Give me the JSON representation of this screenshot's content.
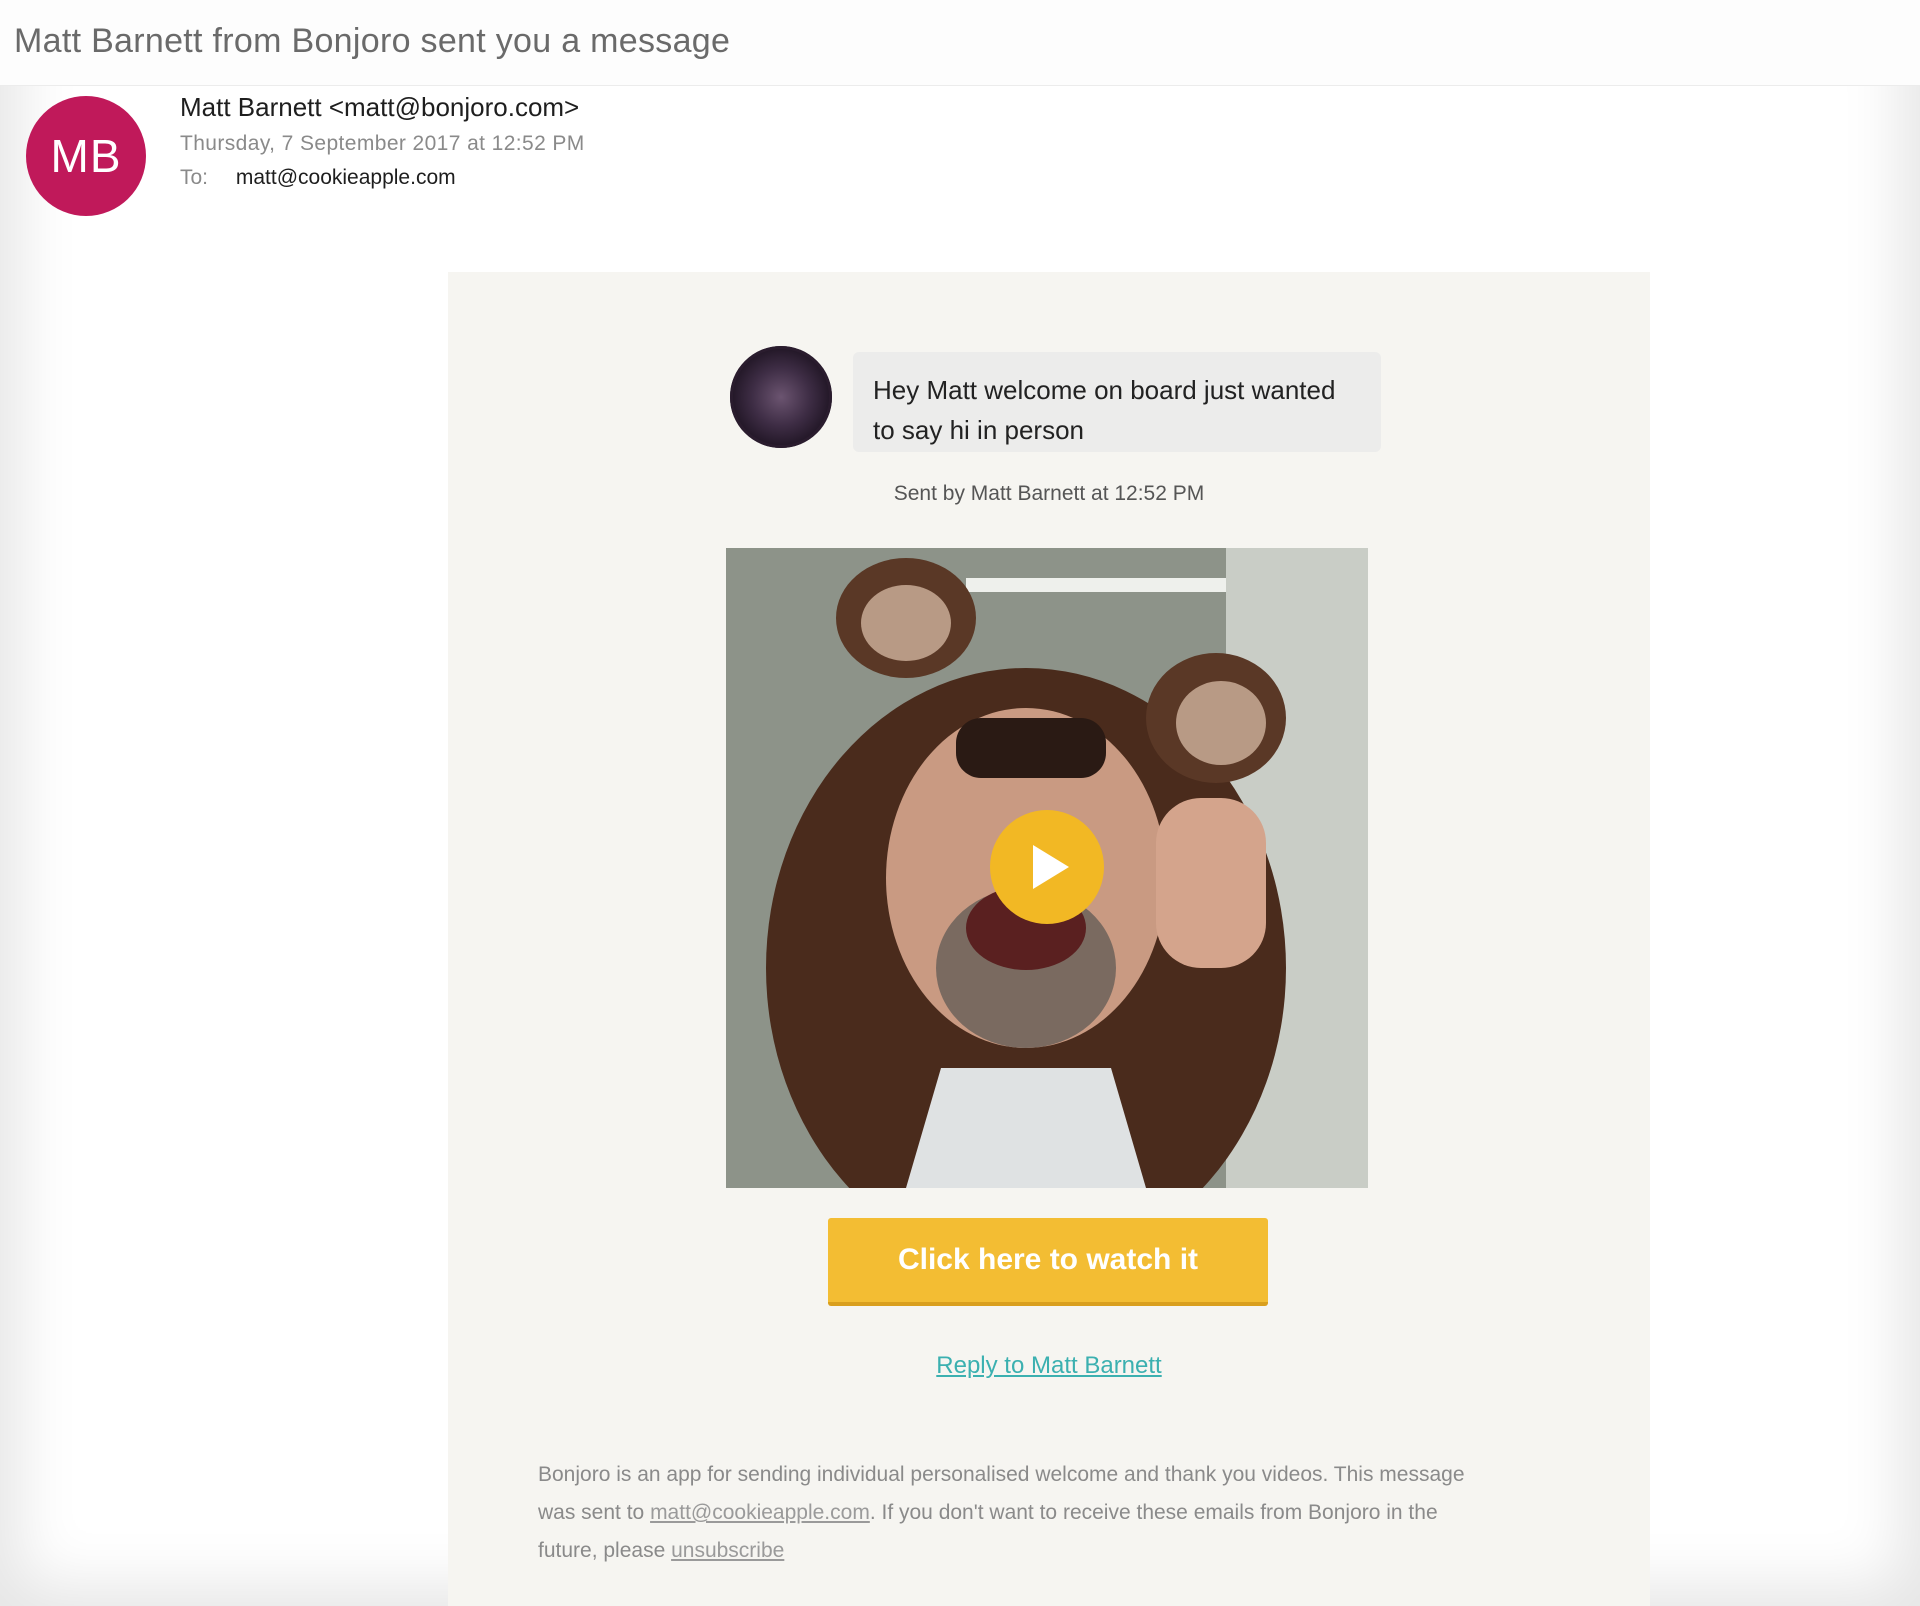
{
  "email": {
    "subject": "Matt Barnett from Bonjoro sent you a message",
    "avatar_initials": "MB",
    "from": "Matt Barnett <matt@bonjoro.com>",
    "date": "Thursday, 7 September 2017 at 12:52 PM",
    "to_label": "To:",
    "to_address": "matt@cookieapple.com"
  },
  "message": {
    "bubble_text": "Hey Matt welcome on board just wanted to say hi in person",
    "sent_by": "Sent by Matt Barnett at 12:52 PM",
    "cta_label": "Click here to watch it",
    "reply_label": "Reply to Matt Barnett"
  },
  "footer": {
    "text_1": "Bonjoro is an app for sending individual personalised welcome and thank you videos. This message was sent to ",
    "recipient_link": "matt@cookieapple.com",
    "text_2": ". If you don't want to receive these emails from Bonjoro in the future, please ",
    "unsubscribe_link": "unsubscribe"
  },
  "colors": {
    "avatar": "#c0195a",
    "cta": "#f3bd33",
    "play_button": "#f2b824",
    "link": "#3bb0b0"
  },
  "icons": {
    "play": "play-icon"
  }
}
